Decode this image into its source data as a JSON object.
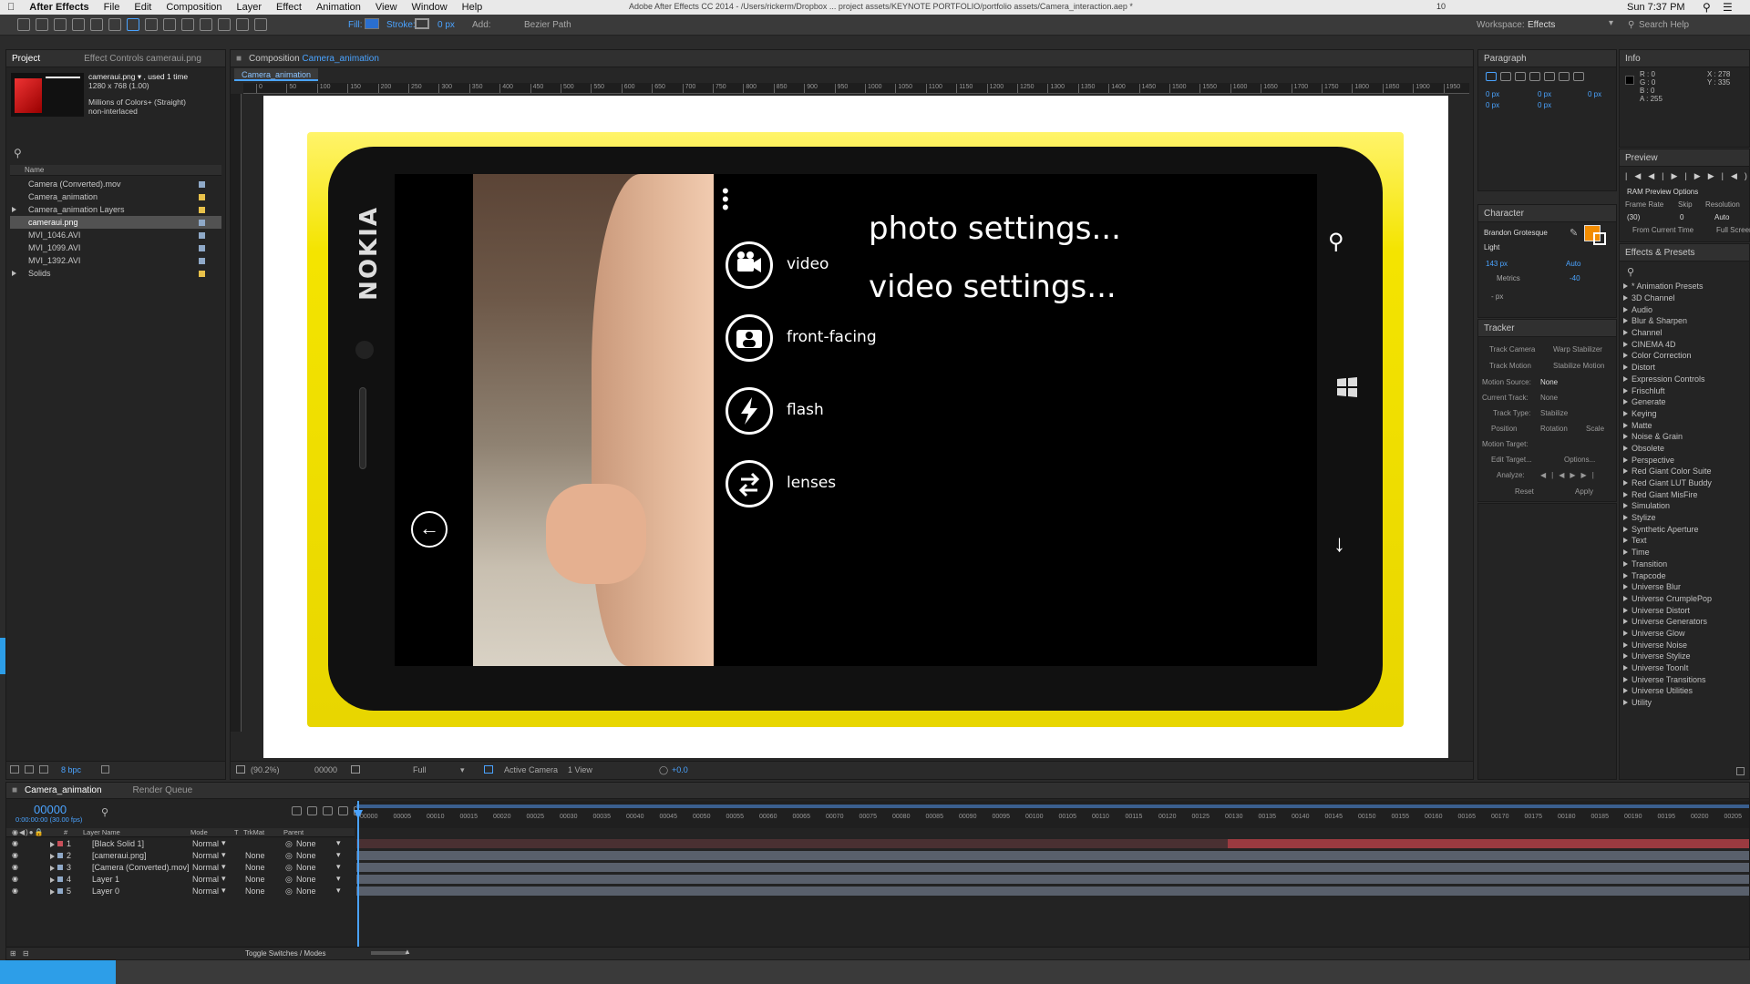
{
  "menubar": {
    "items": [
      "After Effects",
      "File",
      "Edit",
      "Composition",
      "Layer",
      "Effect",
      "Animation",
      "View",
      "Window",
      "Help"
    ],
    "title": "Adobe After Effects CC 2014 - /Users/rickerm/Dropbox ... project assets/KEYNOTE PORTFOLIO/portfolio assets/Camera_interaction.aep *",
    "clock": "Sun 7:37 PM",
    "badge": "10"
  },
  "toolbar": {
    "fill_label": "Fill:",
    "stroke_label": "Stroke:",
    "stroke_width": "0 px",
    "add_label": "Add:",
    "bezier": "Bezier Path",
    "workspace_label": "Workspace:",
    "workspace_value": "Effects",
    "search_help": "Search Help"
  },
  "project": {
    "tab_project": "Project",
    "tab_effect_controls": "Effect Controls cameraui.png",
    "thumb_name": "cameraui.png ▾ , used 1 time",
    "thumb_size": "1280 x 768 (1.00)",
    "thumb_color": "Millions of Colors+ (Straight)",
    "thumb_interlace": "non-interlaced",
    "col_name": "Name",
    "items": [
      {
        "name": "Camera (Converted).mov",
        "color": "#8fa9c8"
      },
      {
        "name": "Camera_animation",
        "color": "#e8c14a"
      },
      {
        "name": "Camera_animation Layers",
        "color": "#e8c14a"
      },
      {
        "name": "cameraui.png",
        "color": "#8fa9c8"
      },
      {
        "name": "MVI_1046.AVI",
        "color": "#8fa9c8"
      },
      {
        "name": "MVI_1099.AVI",
        "color": "#8fa9c8"
      },
      {
        "name": "MVI_1392.AVI",
        "color": "#8fa9c8"
      },
      {
        "name": "Solids",
        "color": "#e8c14a"
      }
    ],
    "bpc": "8 bpc"
  },
  "composition": {
    "tab": "Composition",
    "tab_name": "Camera_animation",
    "sub_tab": "Camera_animation",
    "ruler_marks": [
      "0",
      "50",
      "100",
      "150",
      "200",
      "250",
      "300",
      "350",
      "400",
      "450",
      "500",
      "550",
      "600",
      "650",
      "700",
      "750",
      "800",
      "850",
      "900",
      "950",
      "1000",
      "1050",
      "1100",
      "1150",
      "1200",
      "1250",
      "1300",
      "1350",
      "1400",
      "1450",
      "1500",
      "1550",
      "1600",
      "1650",
      "1700",
      "1750",
      "1800",
      "1850",
      "1900",
      "1950"
    ],
    "zoom": "(90.2%)",
    "timecode": "00000",
    "resolution": "Full",
    "camera": "Active Camera",
    "views": "1 View",
    "exposure": "+0.0"
  },
  "phone": {
    "brand": "NOKIA",
    "menu": [
      {
        "label": "video",
        "icon": "video-camera-icon"
      },
      {
        "label": "front-facing",
        "icon": "front-camera-icon"
      },
      {
        "label": "flash",
        "icon": "flash-icon"
      },
      {
        "label": "lenses",
        "icon": "lenses-icon"
      }
    ],
    "photo_settings": "photo settings...",
    "video_settings": "video settings...",
    "colors": {
      "body": "#f4e400",
      "screen": "#000000"
    }
  },
  "paragraph": {
    "title": "Paragraph",
    "indents": [
      "0 px",
      "0 px",
      "0 px",
      "0 px",
      "0 px"
    ]
  },
  "info": {
    "title": "Info",
    "r": "R : 0",
    "g": "G : 0",
    "b": "B : 0",
    "a": "A : 255",
    "x": "X : 278",
    "y": "Y : 335"
  },
  "preview": {
    "title": "Preview",
    "ram_options": "RAM Preview Options",
    "frame_rate_label": "Frame Rate",
    "skip_label": "Skip",
    "resolution_label": "Resolution",
    "frame_rate": "(30)",
    "skip": "0",
    "resolution": "Auto",
    "from_current": "From Current Time",
    "full_screen": "Full Screen"
  },
  "character": {
    "title": "Character",
    "font": "Brandon Grotesque",
    "style": "Light",
    "size": "143 px",
    "leading": "Auto",
    "kerning": "Metrics",
    "tracking": "-40",
    "stroke": "- px",
    "fill_color": "#f28c00"
  },
  "tracker": {
    "title": "Tracker",
    "track_camera": "Track Camera",
    "warp_stabilizer": "Warp Stabilizer",
    "track_motion": "Track Motion",
    "stabilize_motion": "Stabilize Motion",
    "motion_source_label": "Motion Source:",
    "motion_source": "None",
    "current_track_label": "Current Track:",
    "current_track": "None",
    "track_type_label": "Track Type:",
    "track_type": "Stabilize",
    "position": "Position",
    "rotation": "Rotation",
    "scale": "Scale",
    "motion_target": "Motion Target:",
    "edit_target": "Edit Target...",
    "options": "Options...",
    "analyze": "Analyze:",
    "reset": "Reset",
    "apply": "Apply"
  },
  "effects": {
    "title": "Effects & Presets",
    "items": [
      "* Animation Presets",
      "3D Channel",
      "Audio",
      "Blur & Sharpen",
      "Channel",
      "CINEMA 4D",
      "Color Correction",
      "Distort",
      "Expression Controls",
      "Frischluft",
      "Generate",
      "Keying",
      "Matte",
      "Noise & Grain",
      "Obsolete",
      "Perspective",
      "Red Giant Color Suite",
      "Red Giant LUT Buddy",
      "Red Giant MisFire",
      "Simulation",
      "Stylize",
      "Synthetic Aperture",
      "Text",
      "Time",
      "Transition",
      "Trapcode",
      "Universe Blur",
      "Universe CrumplePop",
      "Universe Distort",
      "Universe Generators",
      "Universe Glow",
      "Universe Noise",
      "Universe Stylize",
      "Universe ToonIt",
      "Universe Transitions",
      "Universe Utilities",
      "Utility"
    ]
  },
  "timeline": {
    "tab": "Camera_animation",
    "render_queue": "Render Queue",
    "timecode": "00000",
    "timecode_sub": "0:00:00:00 (30.00 fps)",
    "col_layer_name": "Layer Name",
    "col_mode": "Mode",
    "col_t": "T",
    "col_trkmat": "TrkMat",
    "col_parent": "Parent",
    "ruler": [
      "00000",
      "00005",
      "00010",
      "00015",
      "00020",
      "00025",
      "00030",
      "00035",
      "00040",
      "00045",
      "00050",
      "00055",
      "00060",
      "00065",
      "00070",
      "00075",
      "00080",
      "00085",
      "00090",
      "00095",
      "00100",
      "00105",
      "00110",
      "00115",
      "00120",
      "00125",
      "00130",
      "00135",
      "00140",
      "00145",
      "00150",
      "00155",
      "00160",
      "00165",
      "00170",
      "00175",
      "00180",
      "00185",
      "00190",
      "00195",
      "00200",
      "00205"
    ],
    "layers": [
      {
        "num": "1",
        "name": "[Black Solid 1]",
        "mode": "Normal",
        "trkmat": "",
        "parent": "None",
        "color": "#c8505a"
      },
      {
        "num": "2",
        "name": "[cameraui.png]",
        "mode": "Normal",
        "trkmat": "None",
        "parent": "None",
        "color": "#8fa9c8"
      },
      {
        "num": "3",
        "name": "[Camera (Converted).mov]",
        "mode": "Normal",
        "trkmat": "None",
        "parent": "None",
        "color": "#8fa9c8"
      },
      {
        "num": "4",
        "name": "Layer 1",
        "mode": "Normal",
        "trkmat": "None",
        "parent": "None",
        "color": "#8fa9c8"
      },
      {
        "num": "5",
        "name": "Layer 0",
        "mode": "Normal",
        "trkmat": "None",
        "parent": "None",
        "color": "#8fa9c8"
      }
    ],
    "toggle": "Toggle Switches / Modes"
  }
}
